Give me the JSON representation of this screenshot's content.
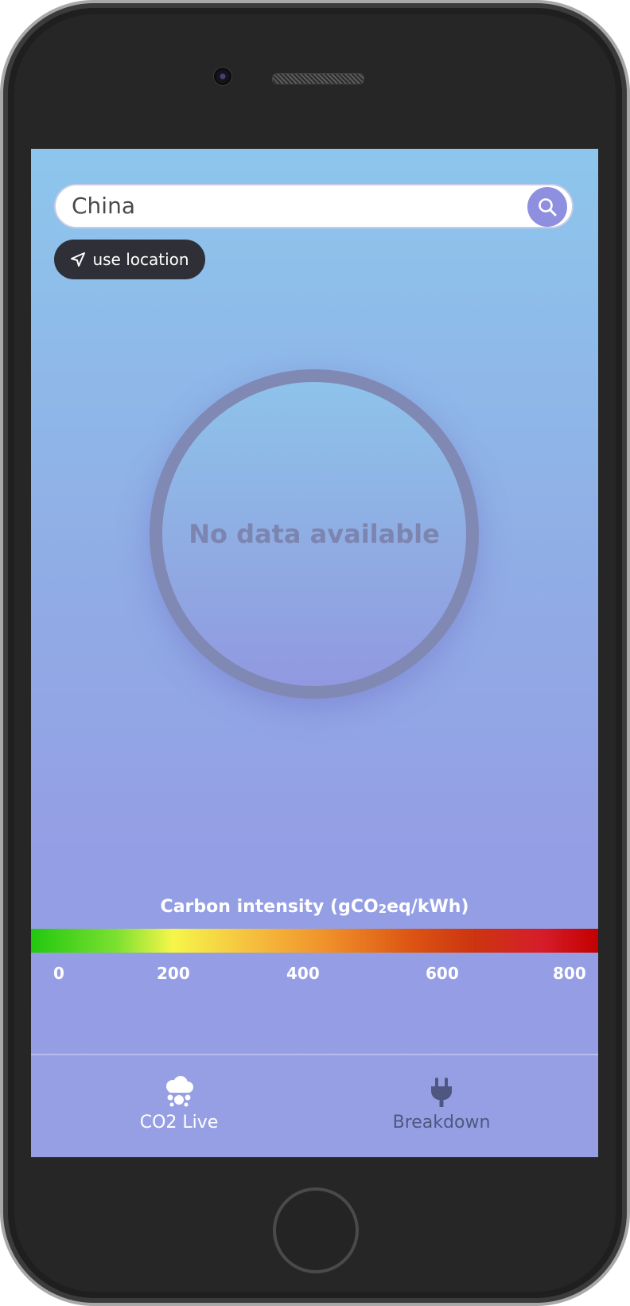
{
  "search": {
    "value": "China",
    "icon": "search-icon"
  },
  "location_button": {
    "label": "use location",
    "icon": "location-arrow-icon"
  },
  "gauge": {
    "text": "No data available"
  },
  "scale": {
    "title_main": "Carbon intensity (gCO",
    "title_sub": "2",
    "title_end": "eq/kWh)",
    "ticks": [
      "0",
      "200",
      "400",
      "600",
      "800"
    ]
  },
  "tabs": [
    {
      "label": "CO2 Live",
      "icon": "cloud-icon",
      "active": true
    },
    {
      "label": "Breakdown",
      "icon": "plug-icon",
      "active": false
    }
  ],
  "colors": {
    "accent": "#8f8fe0",
    "location_button": "#2f3037",
    "active_tab_text": "#ffffff",
    "inactive_tab_text": "#4f5780"
  }
}
